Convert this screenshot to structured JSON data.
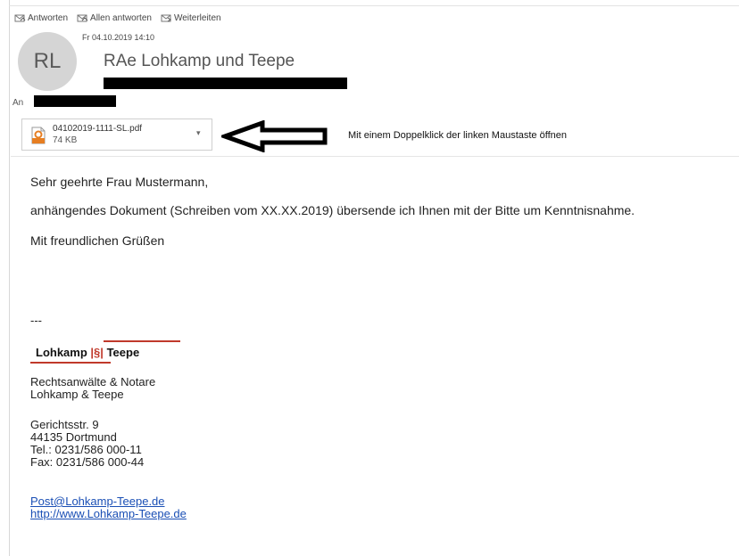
{
  "toolbar": {
    "reply": "Antworten",
    "reply_all": "Allen antworten",
    "forward": "Weiterleiten"
  },
  "header": {
    "date": "Fr 04.10.2019 14:10",
    "avatar_initials": "RL",
    "sender": "RAe Lohkamp und Teepe",
    "to_label": "An"
  },
  "attachment": {
    "filename": "04102019-1111-SL.pdf",
    "size": "74 KB",
    "hint": "Mit einem Doppelklick der linken Maustaste öffnen"
  },
  "body": {
    "greeting": "Sehr geehrte Frau Mustermann,",
    "line": "anhängendes Dokument (Schreiben vom XX.XX.2019) übersende ich Ihnen mit der Bitte um Kenntnisnahme.",
    "closing": "Mit freundlichen Grüßen",
    "separator": "---"
  },
  "signature": {
    "logo_left": "Lohkamp",
    "logo_symbol": "|§|",
    "logo_right": "Teepe",
    "line1": "Rechtsanwälte & Notare",
    "line2": "Lohkamp & Teepe",
    "street": "Gerichtsstr. 9",
    "city": "44135 Dortmund",
    "tel": "Tel.: 0231/586 000-11",
    "fax": "Fax: 0231/586 000-44",
    "email": "Post@Lohkamp-Teepe.de",
    "web": "http://www.Lohkamp-Teepe.de"
  },
  "colors": {
    "logo_red": "#c0392b",
    "link_blue": "#1a4fb5",
    "avatar_bg": "#d5d5d5"
  }
}
